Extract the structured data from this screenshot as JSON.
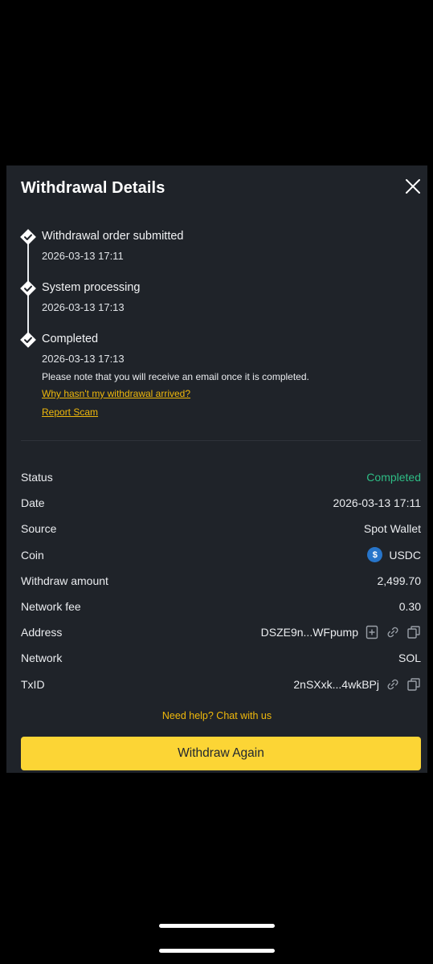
{
  "modal": {
    "title": "Withdrawal Details"
  },
  "timeline": {
    "steps": [
      {
        "label": "Withdrawal order submitted",
        "time": "2026-03-13 17:11"
      },
      {
        "label": "System processing",
        "time": "2026-03-13 17:13"
      },
      {
        "label": "Completed",
        "time": "2026-03-13 17:13"
      }
    ],
    "note": "Please note that you will receive an email once it is completed.",
    "why_link": "Why hasn't my withdrawal arrived?",
    "report_link": "Report Scam"
  },
  "details": {
    "status_label": "Status",
    "status_value": "Completed",
    "date_label": "Date",
    "date_value": "2026-03-13 17:11",
    "source_label": "Source",
    "source_value": "Spot Wallet",
    "coin_label": "Coin",
    "coin_value": "USDC",
    "coin_icon_glyph": "$",
    "amount_label": "Withdraw amount",
    "amount_value": "2,499.70",
    "fee_label": "Network fee",
    "fee_value": "0.30",
    "address_label": "Address",
    "address_value": "DSZE9n...WFpump",
    "network_label": "Network",
    "network_value": "SOL",
    "txid_label": "TxID",
    "txid_value": "2nSXxk...4wkBPj"
  },
  "help_link": "Need help? Chat with us",
  "withdraw_again": "Withdraw Again",
  "colors": {
    "accent": "#fcd535",
    "link": "#f0b90b",
    "success": "#2ebd85",
    "panel": "#1f2329"
  },
  "icons": [
    "close-icon",
    "check-circle-icon",
    "usdc-icon",
    "address-book-icon",
    "link-icon",
    "copy-icon"
  ]
}
